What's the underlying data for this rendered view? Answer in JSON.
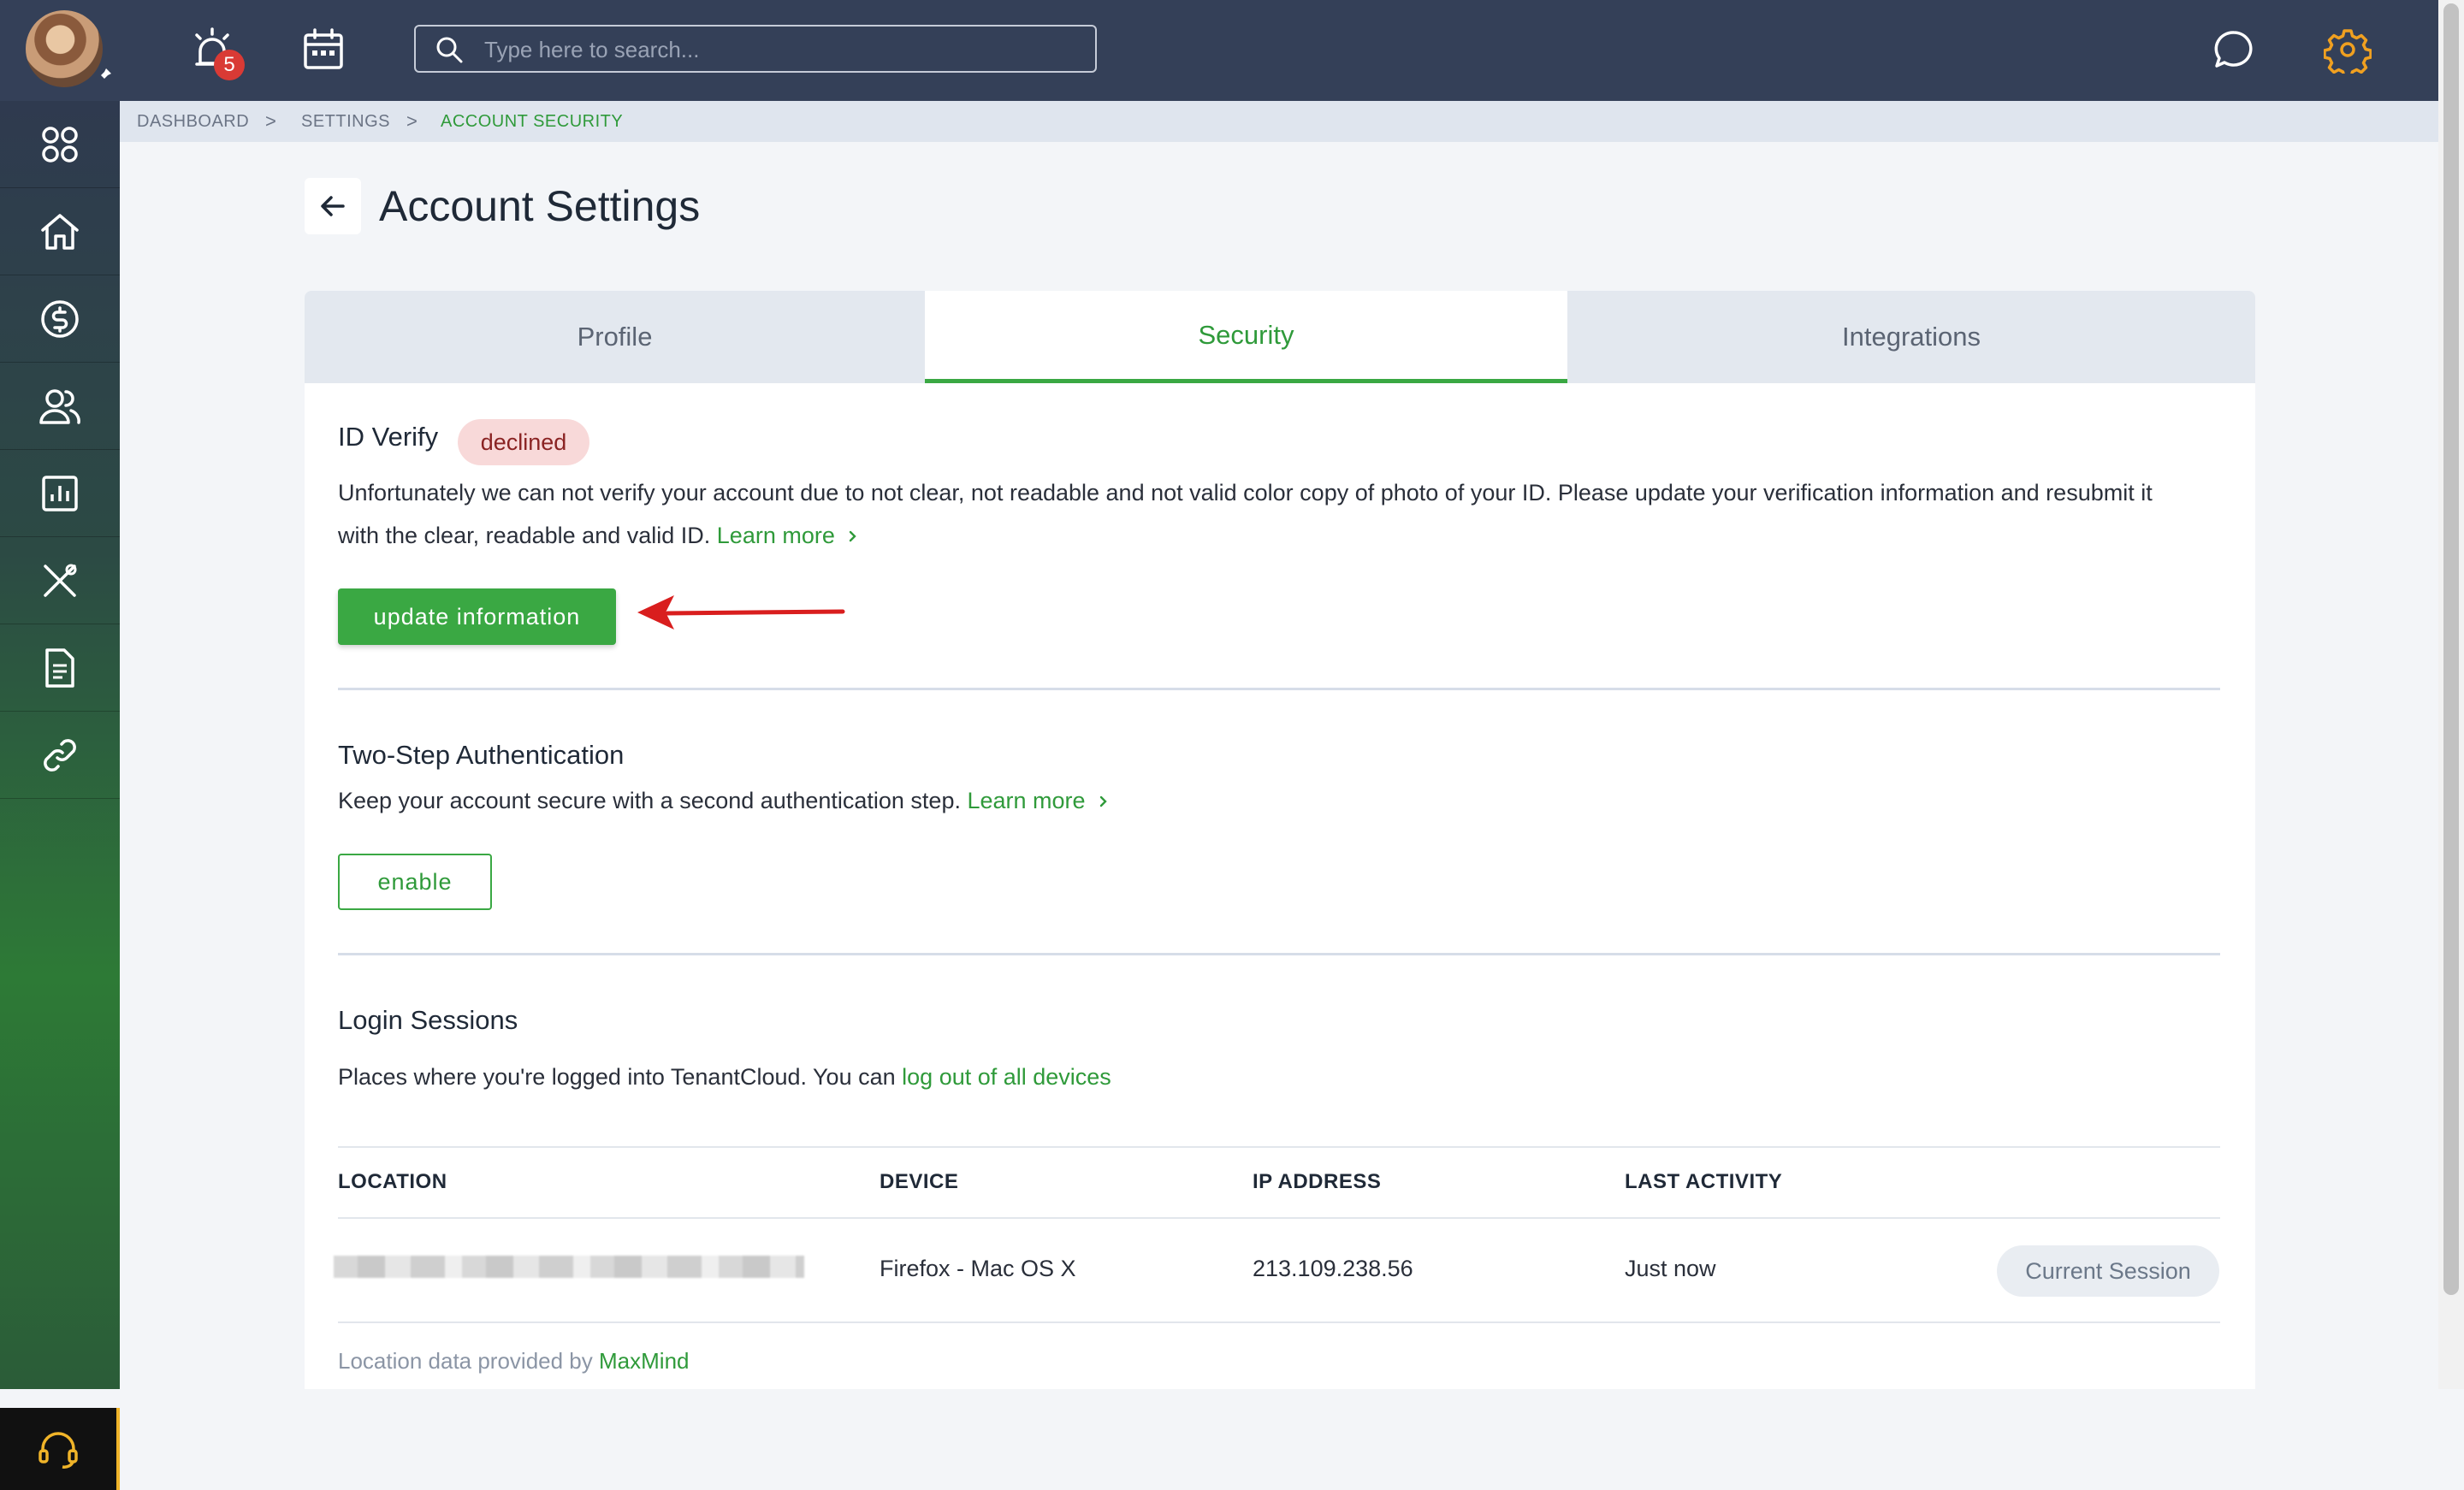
{
  "header": {
    "notification_count": "5",
    "search_placeholder": "Type here to search...",
    "icons": [
      "avatar",
      "pin-icon",
      "alarm-icon",
      "calendar-icon",
      "search-icon",
      "chat-icon",
      "gear-icon"
    ]
  },
  "sidebar": {
    "items": [
      {
        "name": "apps-icon"
      },
      {
        "name": "home-icon"
      },
      {
        "name": "dollar-icon"
      },
      {
        "name": "users-icon"
      },
      {
        "name": "reports-icon"
      },
      {
        "name": "tools-icon"
      },
      {
        "name": "document-icon"
      },
      {
        "name": "link-icon"
      }
    ],
    "support_icon": "headset-icon"
  },
  "breadcrumb": {
    "items": [
      "DASHBOARD",
      "SETTINGS",
      "ACCOUNT SECURITY"
    ],
    "separator": ">"
  },
  "page": {
    "title": "Account Settings"
  },
  "tabs": [
    {
      "label": "Profile",
      "active": false
    },
    {
      "label": "Security",
      "active": true
    },
    {
      "label": "Integrations",
      "active": false
    }
  ],
  "id_verify": {
    "heading": "ID Verify",
    "status": "declined",
    "message": "Unfortunately we can not verify your account due to not clear, not readable and not valid color copy of photo of your ID. Please update your verification information and resubmit it",
    "message_line2": "with the clear, readable and valid ID.",
    "learn_more": "Learn more",
    "button": "update information"
  },
  "two_step": {
    "heading": "Two-Step Authentication",
    "message": "Keep your account secure with a second authentication step.",
    "learn_more": "Learn more",
    "button": "enable"
  },
  "sessions": {
    "heading": "Login Sessions",
    "message": "Places where you're logged into TenantCloud. You can",
    "logout_link": "log out of all devices",
    "columns": [
      "LOCATION",
      "DEVICE",
      "IP ADDRESS",
      "LAST ACTIVITY"
    ],
    "rows": [
      {
        "location": "",
        "device": "Firefox - Mac OS X",
        "ip": "213.109.238.56",
        "last_activity": "Just now",
        "badge": "Current Session"
      }
    ],
    "footnote_prefix": "Location data provided by",
    "footnote_link": "MaxMind"
  },
  "colors": {
    "accent": "#3aa843",
    "topbar": "#344058",
    "declined_bg": "#f8d9d9",
    "gear": "#f0a020",
    "annotation_arrow": "#d91e1e"
  }
}
